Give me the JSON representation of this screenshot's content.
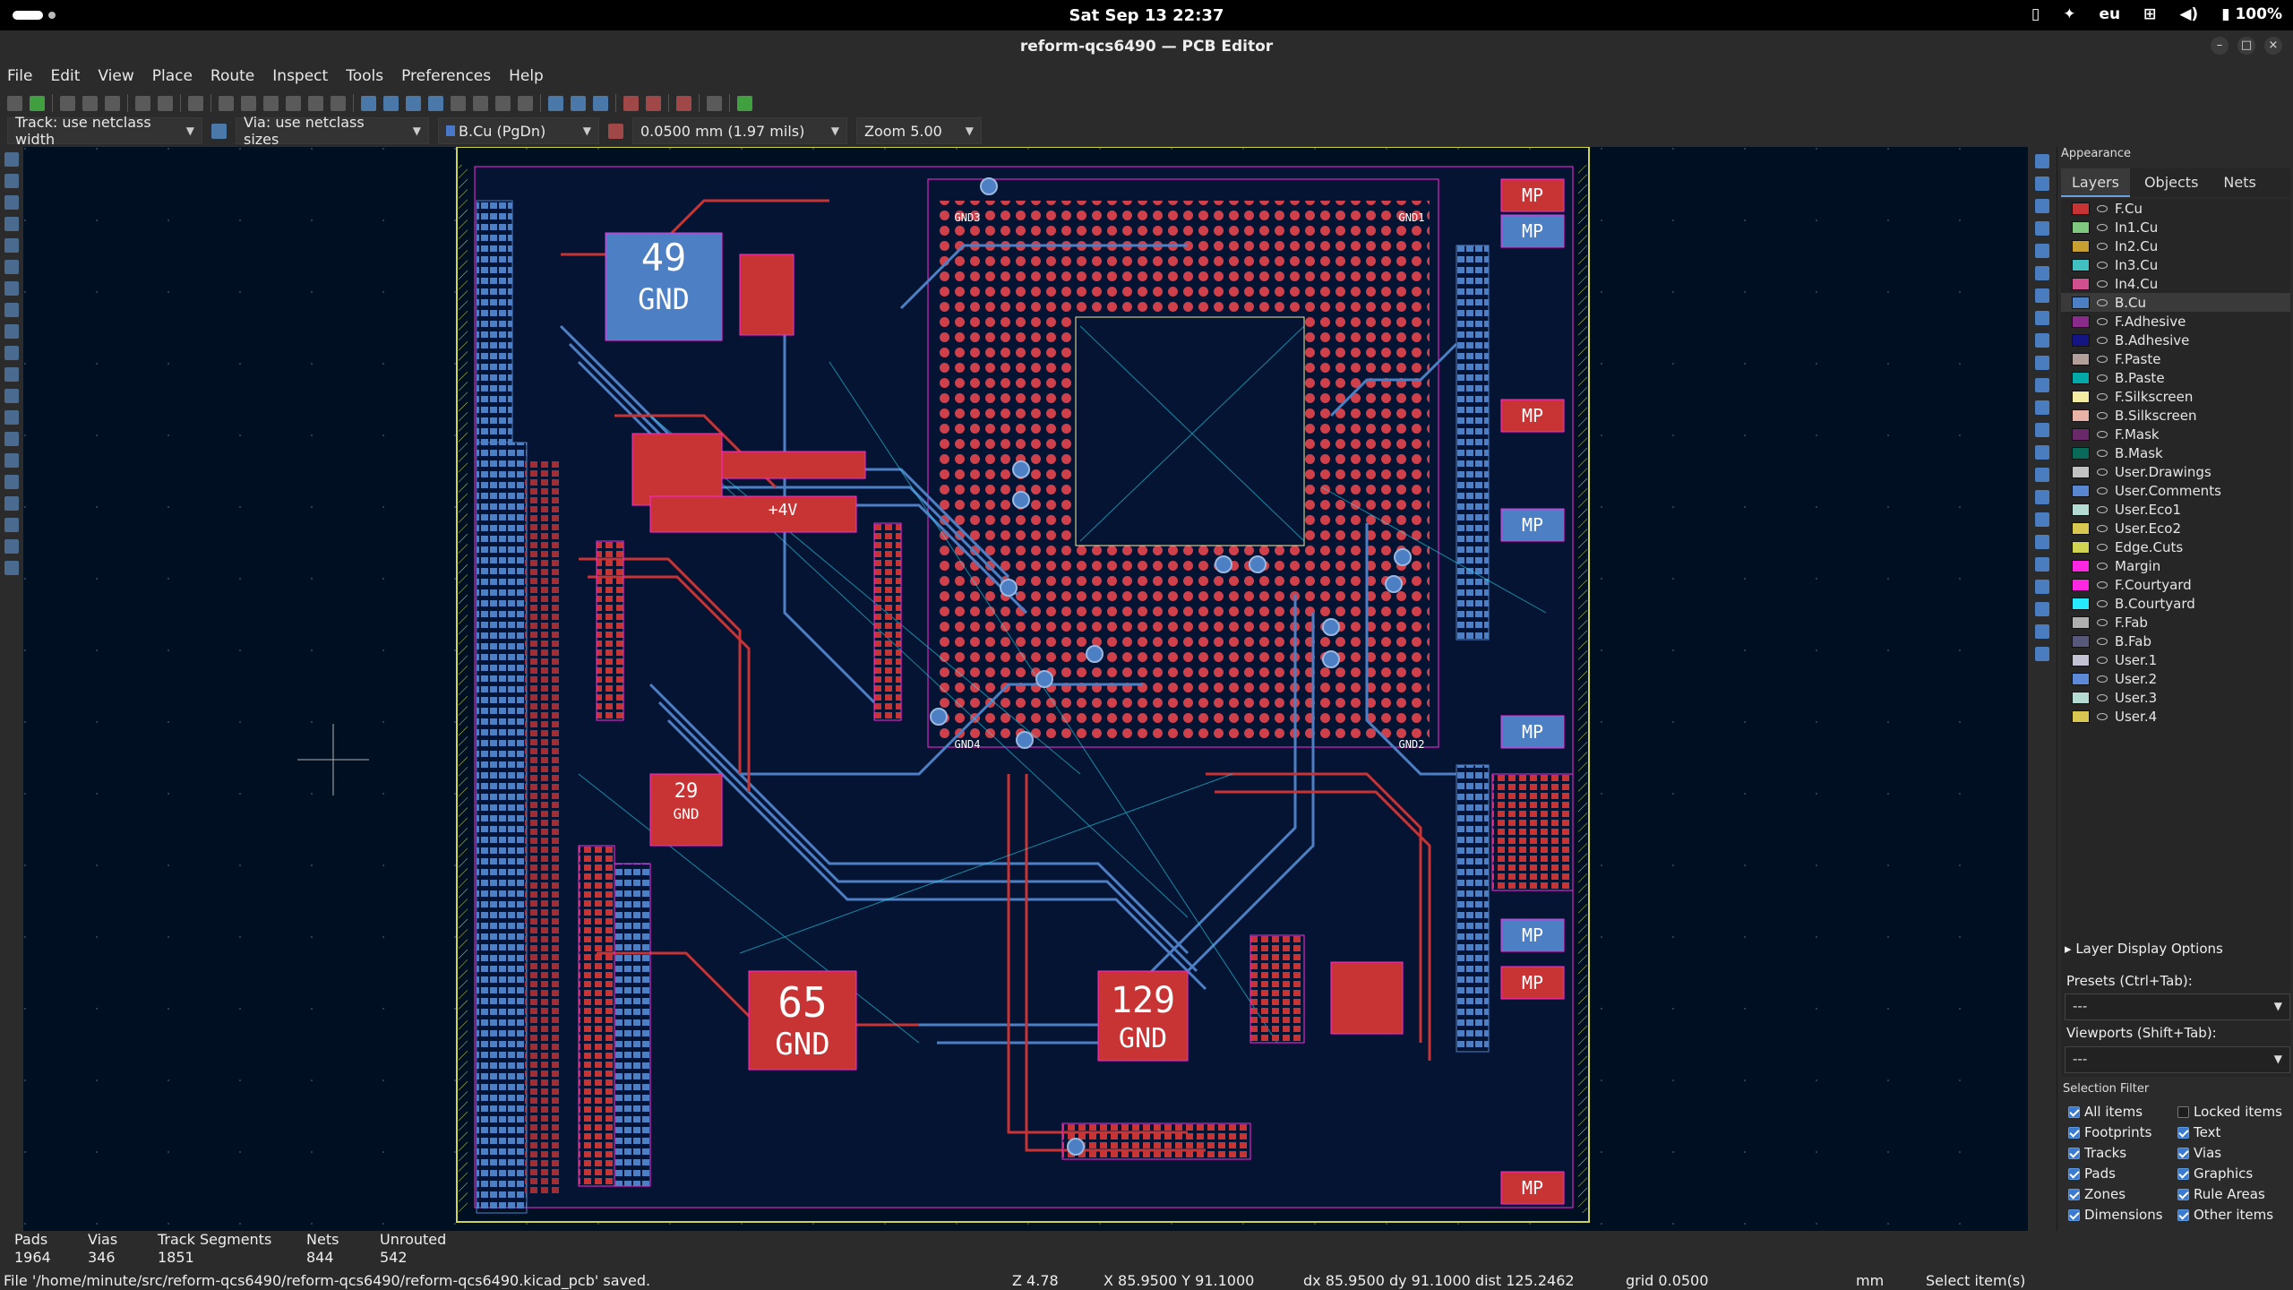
{
  "system": {
    "clock": "Sat Sep 13  22:37",
    "lang": "eu",
    "battery": "100%",
    "icons": [
      "phone-icon",
      "accessibility-icon",
      "network-icon",
      "volume-icon",
      "battery-icon"
    ]
  },
  "window": {
    "title": "reform-qcs6490 — PCB Editor",
    "minimize": "–",
    "maximize": "□",
    "close": "×"
  },
  "menu": [
    "File",
    "Edit",
    "View",
    "Place",
    "Route",
    "Inspect",
    "Tools",
    "Preferences",
    "Help"
  ],
  "toolbar2": {
    "track": "Track: use netclass width",
    "via": "Via: use netclass sizes",
    "layer": "B.Cu (PgDn)",
    "grid": "0.0500 mm (1.97 mils)",
    "zoom": "Zoom 5.00"
  },
  "board_labels": [
    {
      "name": "net-label-49",
      "num": "49",
      "net": "GND"
    },
    {
      "name": "net-label-65",
      "num": "65",
      "net": "GND"
    },
    {
      "name": "net-label-129",
      "num": "129",
      "net": "GND"
    },
    {
      "name": "net-label-29",
      "num": "29",
      "net": "GND"
    }
  ],
  "board_small": {
    "v4": "+4V",
    "gnd1": "GND1",
    "gnd2": "GND2",
    "gnd3": "GND3",
    "gnd4": "GND4",
    "mp": "MP"
  },
  "panel": {
    "title": "Appearance",
    "tabs": [
      "Layers",
      "Objects",
      "Nets"
    ],
    "layers": [
      {
        "name": "F.Cu",
        "color": "#c83434"
      },
      {
        "name": "In1.Cu",
        "color": "#7fc87f"
      },
      {
        "name": "In2.Cu",
        "color": "#c8a030"
      },
      {
        "name": "In3.Cu",
        "color": "#40c0c0"
      },
      {
        "name": "In4.Cu",
        "color": "#d05090"
      },
      {
        "name": "B.Cu",
        "color": "#4d7fc4"
      },
      {
        "name": "F.Adhesive",
        "color": "#8a2a8a"
      },
      {
        "name": "B.Adhesive",
        "color": "#141482"
      },
      {
        "name": "F.Paste",
        "color": "#b4a09a"
      },
      {
        "name": "B.Paste",
        "color": "#00a8a8"
      },
      {
        "name": "F.Silkscreen",
        "color": "#f2eda1"
      },
      {
        "name": "B.Silkscreen",
        "color": "#e8b2a7"
      },
      {
        "name": "F.Mask",
        "color": "#6a2a6a"
      },
      {
        "name": "B.Mask",
        "color": "#0a6a5a"
      },
      {
        "name": "User.Drawings",
        "color": "#c2c2c2"
      },
      {
        "name": "User.Comments",
        "color": "#5986d0"
      },
      {
        "name": "User.Eco1",
        "color": "#b4dbd2"
      },
      {
        "name": "User.Eco2",
        "color": "#d8c852"
      },
      {
        "name": "Edge.Cuts",
        "color": "#d0d252"
      },
      {
        "name": "Margin",
        "color": "#ff26e2"
      },
      {
        "name": "F.Courtyard",
        "color": "#ff26e2"
      },
      {
        "name": "B.Courtyard",
        "color": "#26e9ff"
      },
      {
        "name": "F.Fab",
        "color": "#afafaf"
      },
      {
        "name": "B.Fab",
        "color": "#58587a"
      },
      {
        "name": "User.1",
        "color": "#c2c2d2"
      },
      {
        "name": "User.2",
        "color": "#5c8ad8"
      },
      {
        "name": "User.3",
        "color": "#b4dbd2"
      },
      {
        "name": "User.4",
        "color": "#d8c852"
      }
    ],
    "selected_layer": "B.Cu",
    "layer_display_options": "Layer Display Options",
    "presets_label": "Presets (Ctrl+Tab):",
    "presets_value": "---",
    "viewports_label": "Viewports (Shift+Tab):",
    "viewports_value": "---",
    "selection_filter_title": "Selection Filter",
    "filters": [
      {
        "label": "All items",
        "checked": true
      },
      {
        "label": "Locked items",
        "checked": false
      },
      {
        "label": "Footprints",
        "checked": true
      },
      {
        "label": "Text",
        "checked": true
      },
      {
        "label": "Tracks",
        "checked": true
      },
      {
        "label": "Vias",
        "checked": true
      },
      {
        "label": "Pads",
        "checked": true
      },
      {
        "label": "Graphics",
        "checked": true
      },
      {
        "label": "Zones",
        "checked": true
      },
      {
        "label": "Rule Areas",
        "checked": true
      },
      {
        "label": "Dimensions",
        "checked": true
      },
      {
        "label": "Other items",
        "checked": true
      }
    ]
  },
  "stats": [
    {
      "k": "Pads",
      "v": "1964"
    },
    {
      "k": "Vias",
      "v": "346"
    },
    {
      "k": "Track Segments",
      "v": "1851"
    },
    {
      "k": "Nets",
      "v": "844"
    },
    {
      "k": "Unrouted",
      "v": "542"
    }
  ],
  "statusbar": {
    "message": "File '/home/minute/src/reform-qcs6490/reform-qcs6490/reform-qcs6490.kicad_pcb' saved.",
    "z": "Z 4.78",
    "xy": "X 85.9500  Y 91.1000",
    "dxy": "dx 85.9500  dy 91.1000  dist 125.2462",
    "grid": "grid 0.0500",
    "units": "mm",
    "mode": "Select item(s)"
  }
}
